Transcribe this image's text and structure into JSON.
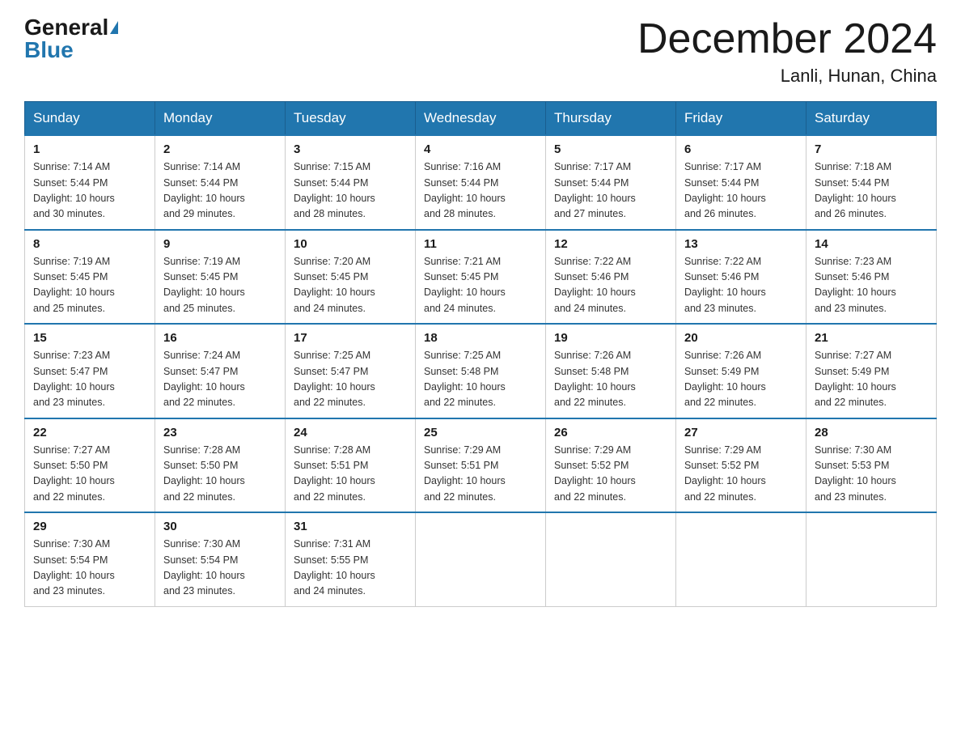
{
  "logo": {
    "general": "General",
    "blue": "Blue"
  },
  "title": "December 2024",
  "subtitle": "Lanli, Hunan, China",
  "weekdays": [
    "Sunday",
    "Monday",
    "Tuesday",
    "Wednesday",
    "Thursday",
    "Friday",
    "Saturday"
  ],
  "weeks": [
    [
      {
        "day": "1",
        "sunrise": "7:14 AM",
        "sunset": "5:44 PM",
        "daylight": "10 hours and 30 minutes."
      },
      {
        "day": "2",
        "sunrise": "7:14 AM",
        "sunset": "5:44 PM",
        "daylight": "10 hours and 29 minutes."
      },
      {
        "day": "3",
        "sunrise": "7:15 AM",
        "sunset": "5:44 PM",
        "daylight": "10 hours and 28 minutes."
      },
      {
        "day": "4",
        "sunrise": "7:16 AM",
        "sunset": "5:44 PM",
        "daylight": "10 hours and 28 minutes."
      },
      {
        "day": "5",
        "sunrise": "7:17 AM",
        "sunset": "5:44 PM",
        "daylight": "10 hours and 27 minutes."
      },
      {
        "day": "6",
        "sunrise": "7:17 AM",
        "sunset": "5:44 PM",
        "daylight": "10 hours and 26 minutes."
      },
      {
        "day": "7",
        "sunrise": "7:18 AM",
        "sunset": "5:44 PM",
        "daylight": "10 hours and 26 minutes."
      }
    ],
    [
      {
        "day": "8",
        "sunrise": "7:19 AM",
        "sunset": "5:45 PM",
        "daylight": "10 hours and 25 minutes."
      },
      {
        "day": "9",
        "sunrise": "7:19 AM",
        "sunset": "5:45 PM",
        "daylight": "10 hours and 25 minutes."
      },
      {
        "day": "10",
        "sunrise": "7:20 AM",
        "sunset": "5:45 PM",
        "daylight": "10 hours and 24 minutes."
      },
      {
        "day": "11",
        "sunrise": "7:21 AM",
        "sunset": "5:45 PM",
        "daylight": "10 hours and 24 minutes."
      },
      {
        "day": "12",
        "sunrise": "7:22 AM",
        "sunset": "5:46 PM",
        "daylight": "10 hours and 24 minutes."
      },
      {
        "day": "13",
        "sunrise": "7:22 AM",
        "sunset": "5:46 PM",
        "daylight": "10 hours and 23 minutes."
      },
      {
        "day": "14",
        "sunrise": "7:23 AM",
        "sunset": "5:46 PM",
        "daylight": "10 hours and 23 minutes."
      }
    ],
    [
      {
        "day": "15",
        "sunrise": "7:23 AM",
        "sunset": "5:47 PM",
        "daylight": "10 hours and 23 minutes."
      },
      {
        "day": "16",
        "sunrise": "7:24 AM",
        "sunset": "5:47 PM",
        "daylight": "10 hours and 22 minutes."
      },
      {
        "day": "17",
        "sunrise": "7:25 AM",
        "sunset": "5:47 PM",
        "daylight": "10 hours and 22 minutes."
      },
      {
        "day": "18",
        "sunrise": "7:25 AM",
        "sunset": "5:48 PM",
        "daylight": "10 hours and 22 minutes."
      },
      {
        "day": "19",
        "sunrise": "7:26 AM",
        "sunset": "5:48 PM",
        "daylight": "10 hours and 22 minutes."
      },
      {
        "day": "20",
        "sunrise": "7:26 AM",
        "sunset": "5:49 PM",
        "daylight": "10 hours and 22 minutes."
      },
      {
        "day": "21",
        "sunrise": "7:27 AM",
        "sunset": "5:49 PM",
        "daylight": "10 hours and 22 minutes."
      }
    ],
    [
      {
        "day": "22",
        "sunrise": "7:27 AM",
        "sunset": "5:50 PM",
        "daylight": "10 hours and 22 minutes."
      },
      {
        "day": "23",
        "sunrise": "7:28 AM",
        "sunset": "5:50 PM",
        "daylight": "10 hours and 22 minutes."
      },
      {
        "day": "24",
        "sunrise": "7:28 AM",
        "sunset": "5:51 PM",
        "daylight": "10 hours and 22 minutes."
      },
      {
        "day": "25",
        "sunrise": "7:29 AM",
        "sunset": "5:51 PM",
        "daylight": "10 hours and 22 minutes."
      },
      {
        "day": "26",
        "sunrise": "7:29 AM",
        "sunset": "5:52 PM",
        "daylight": "10 hours and 22 minutes."
      },
      {
        "day": "27",
        "sunrise": "7:29 AM",
        "sunset": "5:52 PM",
        "daylight": "10 hours and 22 minutes."
      },
      {
        "day": "28",
        "sunrise": "7:30 AM",
        "sunset": "5:53 PM",
        "daylight": "10 hours and 23 minutes."
      }
    ],
    [
      {
        "day": "29",
        "sunrise": "7:30 AM",
        "sunset": "5:54 PM",
        "daylight": "10 hours and 23 minutes."
      },
      {
        "day": "30",
        "sunrise": "7:30 AM",
        "sunset": "5:54 PM",
        "daylight": "10 hours and 23 minutes."
      },
      {
        "day": "31",
        "sunrise": "7:31 AM",
        "sunset": "5:55 PM",
        "daylight": "10 hours and 24 minutes."
      },
      null,
      null,
      null,
      null
    ]
  ],
  "labels": {
    "sunrise": "Sunrise:",
    "sunset": "Sunset:",
    "daylight": "Daylight:"
  }
}
